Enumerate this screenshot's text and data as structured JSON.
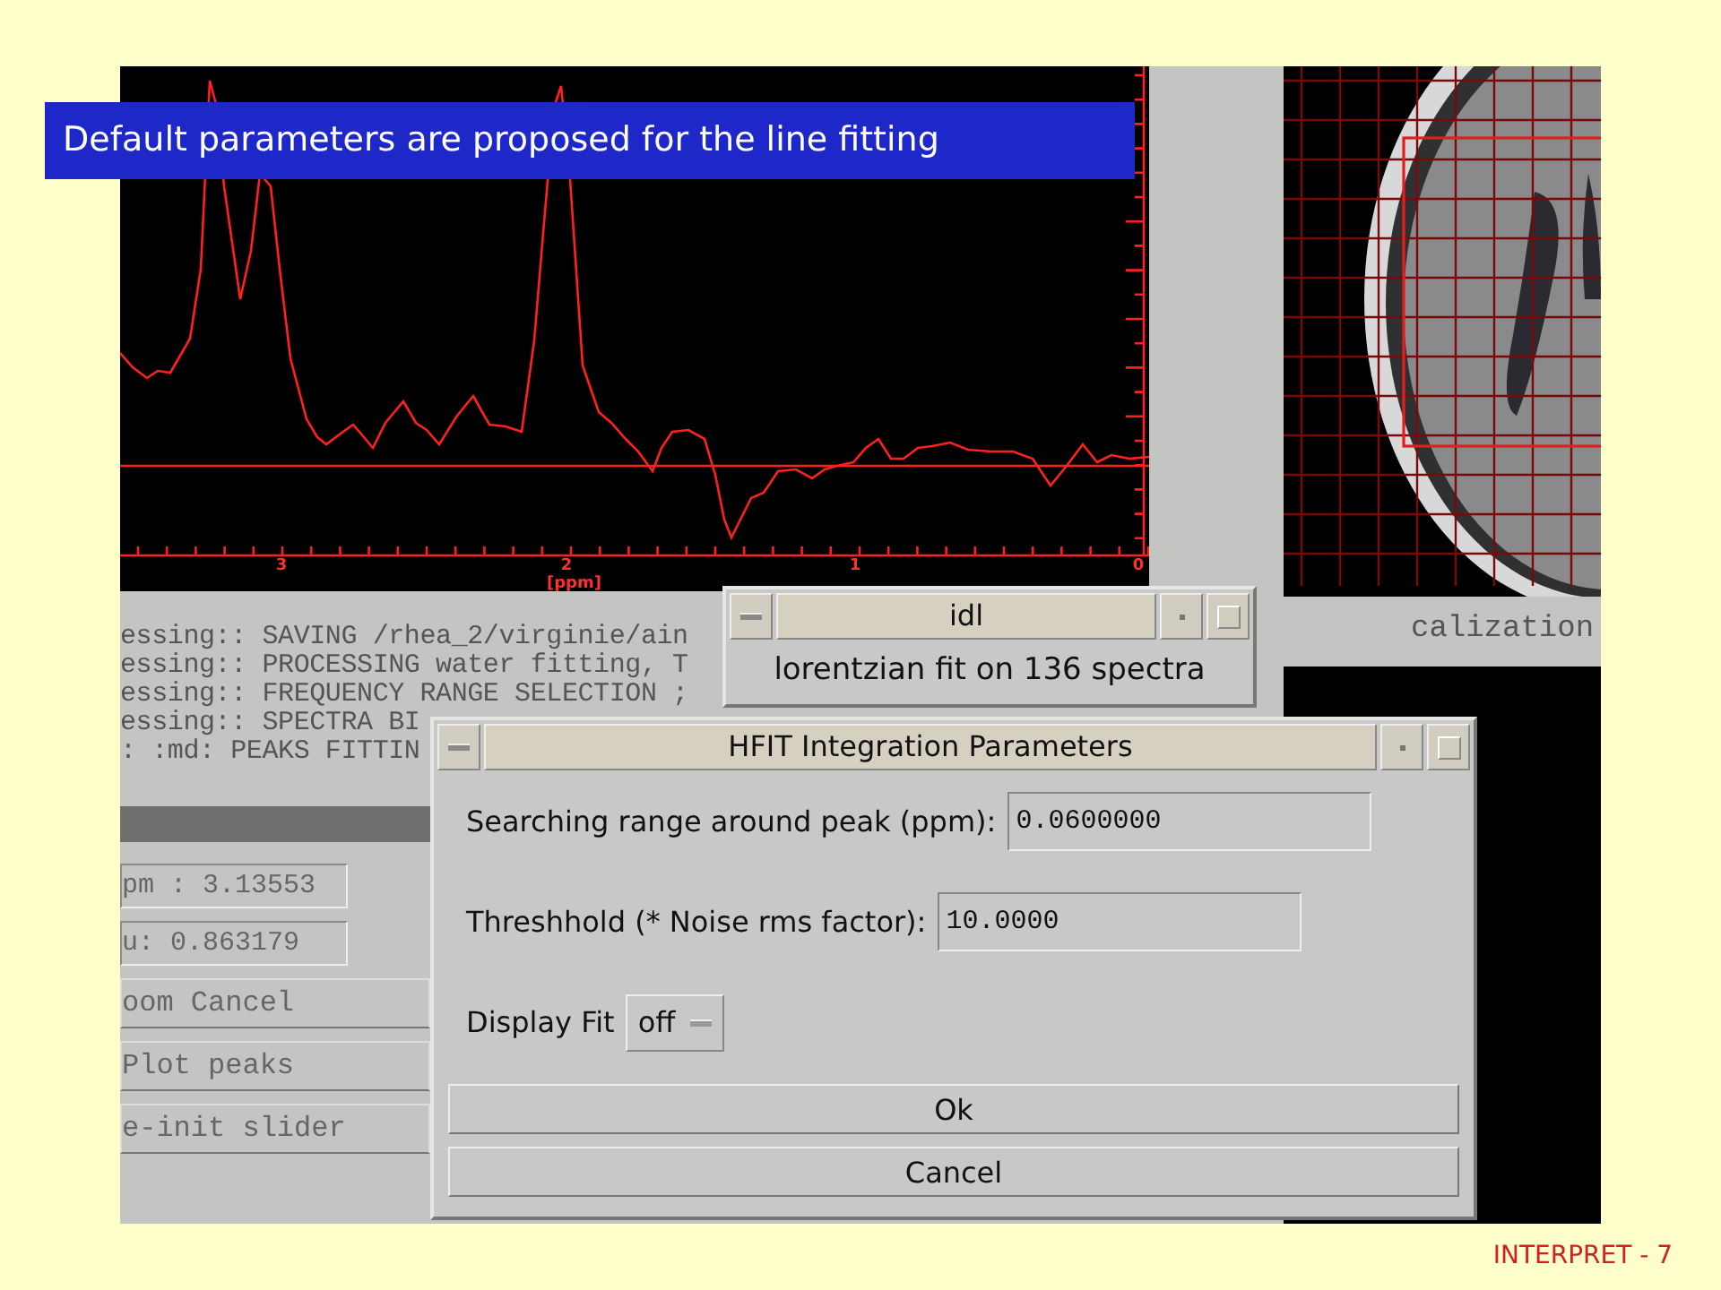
{
  "caption": "Default parameters are proposed for the line fitting",
  "spectrum": {
    "x_tick_labels": [
      "3",
      "2",
      "1",
      "0"
    ],
    "x_unit": "[ppm]"
  },
  "image_panel": {
    "kind": "picture",
    "label": "calization"
  },
  "log_lines": [
    "essing:: SAVING /rhea_2/virginie/ain",
    "essing:: PROCESSING water fitting, T",
    "essing:: FREQUENCY RANGE SELECTION ;",
    "essing:: SPECTRA BI",
    ": :md: PEAKS FITTIN"
  ],
  "readouts": [
    "pm : 3.13553",
    "u: 0.863179"
  ],
  "side_buttons": [
    "oom Cancel",
    "Plot peaks",
    "e-init slider"
  ],
  "message_window": {
    "title": "idl",
    "message": "lorentzian fit on 136 spectra"
  },
  "dialog": {
    "title": "HFIT Integration Parameters",
    "fields": [
      {
        "label": "Searching range around peak (ppm):",
        "value": "0.0600000"
      },
      {
        "label": "Threshhold (* Noise rms factor):",
        "value": "10.0000"
      }
    ],
    "option": {
      "label": "Display Fit",
      "value": "off"
    },
    "buttons": [
      "Ok",
      "Cancel"
    ]
  },
  "footer": "INTERPRET - 7"
}
